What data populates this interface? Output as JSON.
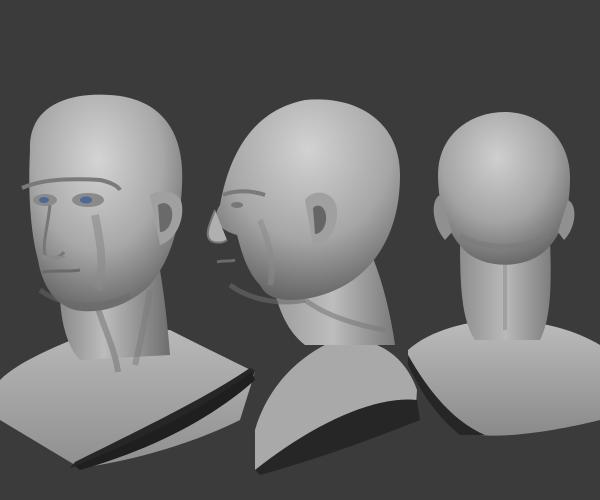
{
  "scene": {
    "background_color": "#3b3b3b",
    "clay_color_light": "#c9c9c9",
    "clay_color_mid": "#9a9a9a",
    "clay_color_dark": "#4a4a4a",
    "cavity_color": "#262626",
    "eye_color": "#4a6a95"
  },
  "views": [
    {
      "name": "three-quarter-front-view",
      "subject": "male-head-bust"
    },
    {
      "name": "profile-side-view",
      "subject": "male-head-bust"
    },
    {
      "name": "back-view",
      "subject": "male-head-bust"
    }
  ]
}
